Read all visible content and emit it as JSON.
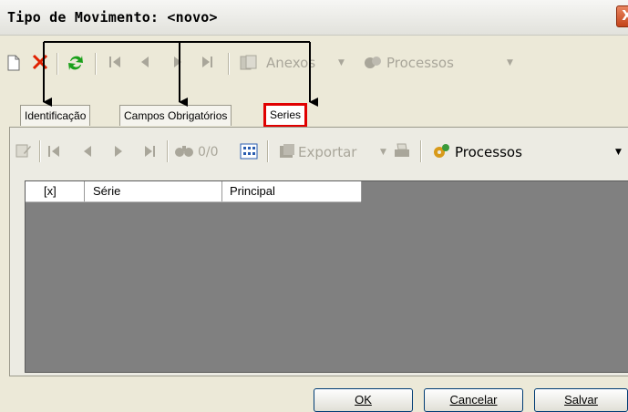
{
  "window": {
    "title": "Tipo de Movimento: <novo>",
    "close_glyph": "X"
  },
  "toolbar_top": {
    "anexos_label": "Anexos",
    "processos_label": "Processos"
  },
  "tabs": [
    {
      "label": "Identificação",
      "active": false
    },
    {
      "label": "Campos Obrigatórios",
      "active": false
    },
    {
      "label": "Series",
      "active": true
    }
  ],
  "grid_toolbar": {
    "counter": "0/0",
    "exportar_label": "Exportar",
    "processos_label": "Processos"
  },
  "grid": {
    "columns": [
      "[x]",
      "Série",
      "Principal"
    ]
  },
  "buttons": {
    "ok_label": "OK",
    "cancel_label": "Cancelar",
    "save_label": "Salvar"
  },
  "icons": {
    "new": "new-document-icon",
    "delete": "delete-icon",
    "refresh": "refresh-icon",
    "first": "first-record-icon",
    "prev": "previous-record-icon",
    "next": "next-record-icon",
    "last": "last-record-icon",
    "attach": "attachment-icon",
    "process": "process-icon",
    "edit": "edit-record-icon",
    "find": "binoculars-icon",
    "columns": "grid-columns-icon",
    "export": "export-icon",
    "print": "print-icon",
    "process_active": "processes-gear-icon"
  },
  "colors": {
    "highlight_box": "#e00000",
    "delete": "#e02000",
    "refresh": "#1aa01a",
    "grid_bg": "#808080"
  }
}
